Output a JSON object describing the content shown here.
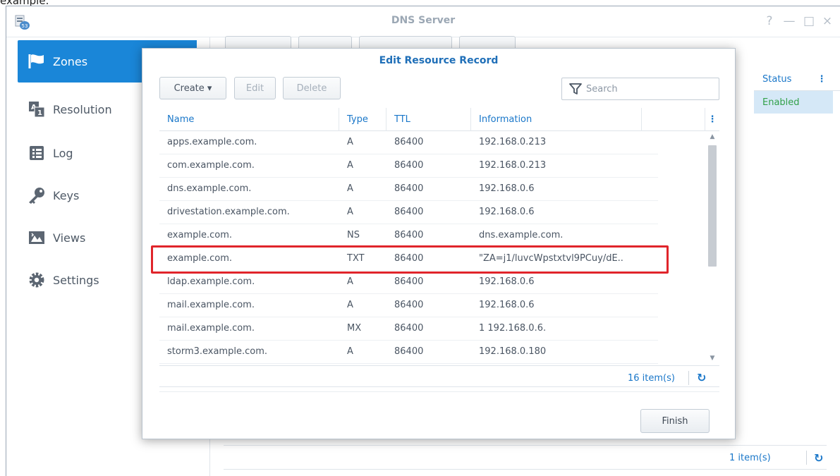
{
  "page_text": "example.",
  "window": {
    "title": "DNS Server",
    "controls": [
      "?",
      "—",
      "□",
      "×"
    ]
  },
  "sidebar": {
    "items": [
      {
        "label": "Zones",
        "icon": "zones-flag-icon",
        "active": true
      },
      {
        "label": "Resolution",
        "icon": "resolution-icon",
        "active": false
      },
      {
        "label": "Log",
        "icon": "log-icon",
        "active": false
      },
      {
        "label": "Keys",
        "icon": "key-icon",
        "active": false
      },
      {
        "label": "Views",
        "icon": "views-icon",
        "active": false
      },
      {
        "label": "Settings",
        "icon": "gear-icon",
        "active": false
      }
    ]
  },
  "background": {
    "status_header": "Status",
    "header_menu": "⋮",
    "status_value": "Enabled",
    "item_count": "1 item(s)",
    "refresh": "↻"
  },
  "dialog": {
    "title": "Edit Resource Record",
    "toolbar": {
      "create_label": "Create ▾",
      "edit_label": "Edit",
      "delete_label": "Delete"
    },
    "search": {
      "placeholder": "Search",
      "value": ""
    },
    "columns": [
      "Name",
      "Type",
      "TTL",
      "Information"
    ],
    "column_menu": "⋮",
    "rows": [
      {
        "name": "apps.example.com.",
        "type": "A",
        "ttl": "86400",
        "info": "192.168.0.213"
      },
      {
        "name": "com.example.com.",
        "type": "A",
        "ttl": "86400",
        "info": "192.168.0.213"
      },
      {
        "name": "dns.example.com.",
        "type": "A",
        "ttl": "86400",
        "info": "192.168.0.6"
      },
      {
        "name": "drivestation.example.com.",
        "type": "A",
        "ttl": "86400",
        "info": "192.168.0.6"
      },
      {
        "name": "example.com.",
        "type": "NS",
        "ttl": "86400",
        "info": "dns.example.com."
      },
      {
        "name": "example.com.",
        "type": "TXT",
        "ttl": "86400",
        "info": "\"ZA=j1/luvcWpstxtvl9PCuy/dE.."
      },
      {
        "name": "ldap.example.com.",
        "type": "A",
        "ttl": "86400",
        "info": "192.168.0.6"
      },
      {
        "name": "mail.example.com.",
        "type": "A",
        "ttl": "86400",
        "info": "192.168.0.6"
      },
      {
        "name": "mail.example.com.",
        "type": "MX",
        "ttl": "86400",
        "info": "1 192.168.0.6."
      },
      {
        "name": "storm3.example.com.",
        "type": "A",
        "ttl": "86400",
        "info": "192.168.0.180"
      }
    ],
    "highlighted_row_index": 5,
    "item_count": "16 item(s)",
    "refresh": "↻",
    "finish_label": "Finish"
  },
  "colors": {
    "accent": "#1a86d8",
    "link": "#1a77c9",
    "enabled": "#33a14a",
    "highlight": "#e0252b"
  }
}
